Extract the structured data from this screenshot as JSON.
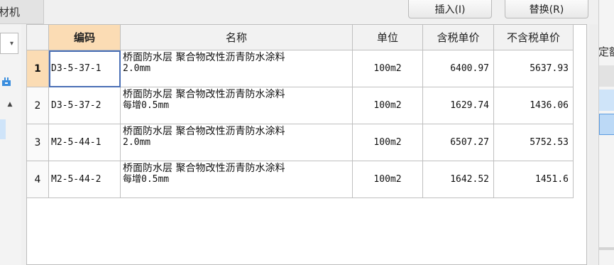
{
  "left_tab": {
    "label": "材机"
  },
  "toolbar": {
    "insert_label": "插入(I)",
    "replace_label": "替换(R)"
  },
  "left_panel": {
    "combo_arrow": "▾",
    "icon": "tree-add-icon",
    "scroll_up": "▲"
  },
  "right_panel": {
    "partial_text": "定额"
  },
  "table": {
    "headers": [
      "",
      "编码",
      "名称",
      "单位",
      "含税单价",
      "不含税单价"
    ],
    "rows": [
      {
        "n": "1",
        "code": "D3-5-37-1",
        "name": "桥面防水层 聚合物改性沥青防水涂料",
        "spec": "2.0mm",
        "unit": "100m2",
        "tax_price": "6400.97",
        "notax_price": "5637.93"
      },
      {
        "n": "2",
        "code": "D3-5-37-2",
        "name": "桥面防水层 聚合物改性沥青防水涂料",
        "spec": "每增0.5mm",
        "unit": "100m2",
        "tax_price": "1629.74",
        "notax_price": "1436.06"
      },
      {
        "n": "3",
        "code": "M2-5-44-1",
        "name": "桥面防水层 聚合物改性沥青防水涂料",
        "spec": "2.0mm",
        "unit": "100m2",
        "tax_price": "6507.27",
        "notax_price": "5752.53"
      },
      {
        "n": "4",
        "code": "M2-5-44-2",
        "name": "桥面防水层 聚合物改性沥青防水涂料",
        "spec": "每增0.5mm",
        "unit": "100m2",
        "tax_price": "1642.52",
        "notax_price": "1451.6"
      }
    ]
  }
}
